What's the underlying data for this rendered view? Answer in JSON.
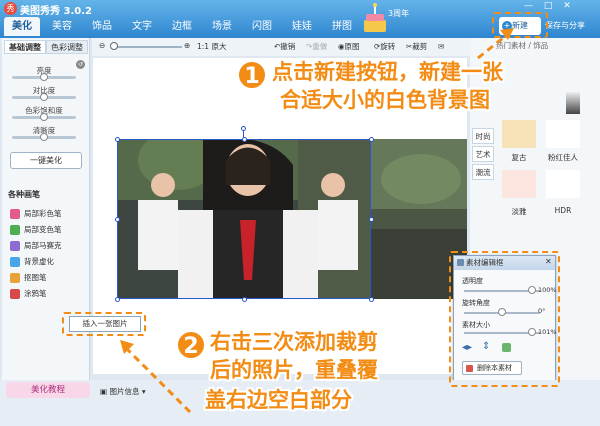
{
  "app": {
    "title": "美图秀秀 3.0.2",
    "anniversary": "3周年",
    "logo_glyph": "秀"
  },
  "tabs": [
    "美化",
    "美容",
    "饰品",
    "文字",
    "边框",
    "场景",
    "闪图",
    "娃娃",
    "拼图"
  ],
  "header_buttons": {
    "new": "新建",
    "save": "保存与分享"
  },
  "left_panel": {
    "subtabs": [
      "基础调整",
      "色彩调整"
    ],
    "sliders": [
      {
        "label": "亮度"
      },
      {
        "label": "对比度"
      },
      {
        "label": "色彩饱和度"
      },
      {
        "label": "清晰度"
      }
    ],
    "auto_beauty": "一键美化",
    "brush_title": "各种画笔",
    "brushes": [
      {
        "label": "局部彩色笔",
        "color": "#e25b8c"
      },
      {
        "label": "局部变色笔",
        "color": "#4caf50"
      },
      {
        "label": "局部马赛克",
        "color": "#8e6bd1"
      },
      {
        "label": "背景虚化",
        "color": "#47a6e8"
      },
      {
        "label": "抠图笔",
        "color": "#e8a23a"
      },
      {
        "label": "涂鸦笔",
        "color": "#d84a4a"
      }
    ]
  },
  "toolbar": {
    "zoom_label": "1:1 原大",
    "undo": "撤销",
    "redo": "重做",
    "original": "原图",
    "rotate": "旋转",
    "crop": "裁剪"
  },
  "insert_button": "插入一张图片",
  "right_panel": {
    "header": "热门素材 / 饰品",
    "side_tabs": [
      "时尚",
      "艺术",
      "潮流"
    ],
    "thumbs": [
      {
        "label": "复古",
        "color": "#f8e2b8"
      },
      {
        "label": "粉红佳人",
        "color": "#ffffff"
      },
      {
        "label": "淡雅",
        "color": "#fde5e0"
      },
      {
        "label": "HDR",
        "color": "#ffffff"
      }
    ]
  },
  "dialog": {
    "title": "素材编辑框",
    "opacity_label": "透明度",
    "opacity_value": "100%",
    "rotate_label": "旋转角度",
    "rotate_value": "0°",
    "size_label": "素材大小",
    "size_value": "101%",
    "delete": "删除本素材"
  },
  "bottom": {
    "tutorial": "美化教程",
    "photo_info": "图片信息"
  },
  "annotations": {
    "step1_num": "1",
    "step1_line1": "点击新建按钮，新建一张",
    "step1_line2": "合适大小的白色背景图",
    "step2_num": "2",
    "step2_line1": "右击三次添加裁剪",
    "step2_line2": "后的照片，重叠覆",
    "step2_line3": "盖右边空白部分"
  },
  "colors": {
    "accent": "#f28c14",
    "titlebar": "#2f86cf"
  }
}
